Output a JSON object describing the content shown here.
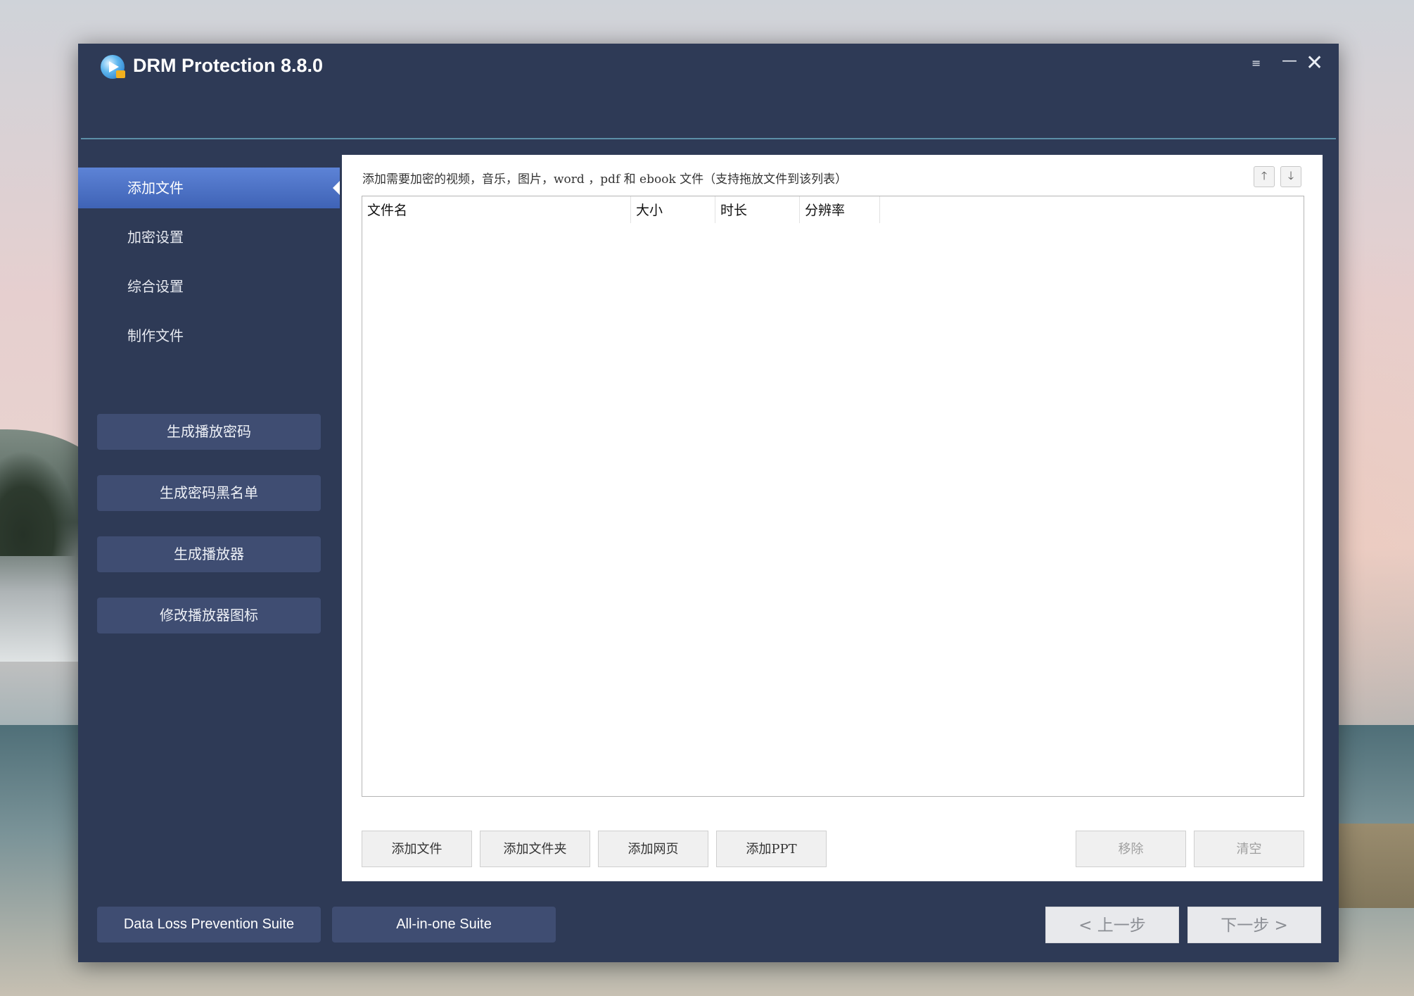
{
  "app": {
    "title": "DRM Protection 8.8.0",
    "menu_glyph": "≡",
    "minimize_glyph": "—",
    "close_glyph": "✕"
  },
  "nav": {
    "items": [
      {
        "label": "添加文件",
        "active": true
      },
      {
        "label": "加密设置"
      },
      {
        "label": "综合设置"
      },
      {
        "label": "制作文件"
      }
    ]
  },
  "side_buttons": {
    "gen_play_password": "生成播放密码",
    "gen_password_blacklist": "生成密码黑名单",
    "gen_player": "生成播放器",
    "change_player_icon": "修改播放器图标"
  },
  "content": {
    "hint": "添加需要加密的视频，音乐，图片，word ，pdf 和 ebook  文件（支持拖放文件到该列表）",
    "move_up": "🡑",
    "move_down": "🡓",
    "table": {
      "columns": [
        "文件名",
        "大小",
        "时长",
        "分辨率"
      ],
      "rows": []
    },
    "actions": {
      "add_file": "添加文件",
      "add_folder": "添加文件夹",
      "add_webpage": "添加网页",
      "add_ppt": "添加PPT",
      "remove": "移除",
      "clear": "清空"
    }
  },
  "footer": {
    "dlp_suite": "Data Loss Prevention Suite",
    "all_in_one": "All-in-one Suite",
    "prev": "< 上一步",
    "next": "下一步 >"
  },
  "colors": {
    "window_bg": "#2e3a56",
    "nav_active": "#4a6fc4",
    "button_bg": "#3f4d72"
  }
}
